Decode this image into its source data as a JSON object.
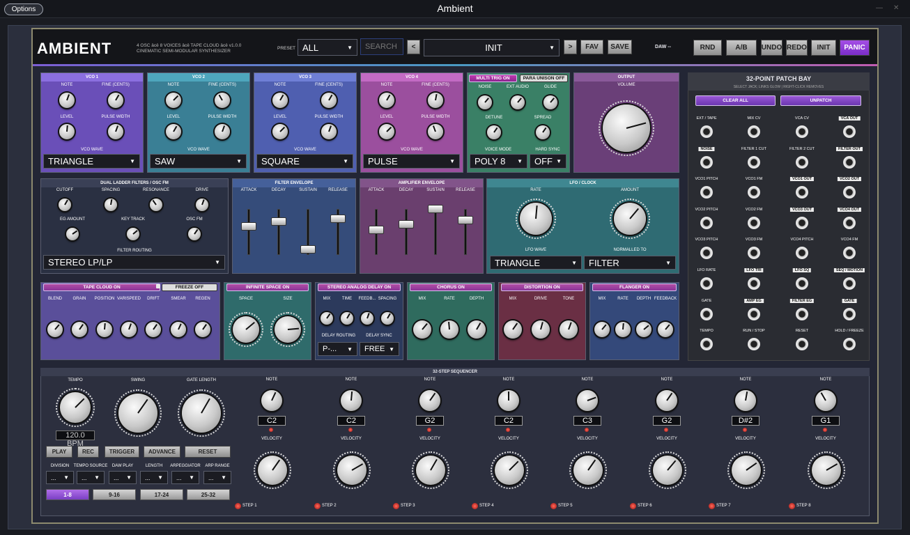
{
  "window": {
    "options": "Options",
    "title": "Ambient"
  },
  "header": {
    "logo": "AMBIENT",
    "subtitle1": "4 OSC  âcê  8 VOICES  âcê  TAPE CLOUD  âcê  v1.0.0",
    "subtitle2": "CINEMATIC SEMI-MODULAR SYNTHESIZER",
    "preset_label": "PRESET",
    "preset_value": "ALL",
    "search_placeholder": "SEARCH",
    "prev": "<",
    "patch": "INIT",
    "next": ">",
    "fav": "FAV",
    "save": "SAVE",
    "daw": "DAW --",
    "rnd": "RND",
    "ab": "A/B",
    "undo": "UNDO",
    "redo": "REDO",
    "init": "INIT",
    "panic": "PANIC"
  },
  "vco": [
    {
      "title": "VCO 1",
      "wave": "TRIANGLE"
    },
    {
      "title": "VCO 2",
      "wave": "SAW"
    },
    {
      "title": "VCO 3",
      "wave": "SQUARE"
    },
    {
      "title": "VCO 4",
      "wave": "PULSE"
    }
  ],
  "vco_labels": {
    "note": "NOTE",
    "fine": "FINE (CENTS)",
    "level": "LEVEL",
    "pw": "PULSE WIDTH",
    "wave": "VCO WAVE"
  },
  "voice": {
    "multi": "MULTI TRIG ON",
    "para": "PARA UNISON OFF",
    "noise": "NOISE",
    "ext": "EXT AUDIO",
    "glide": "GLIDE",
    "detune": "DETUNE",
    "spread": "SPREAD",
    "mode_label": "VOICE MODE",
    "sync_label": "HARD SYNC",
    "mode": "POLY 8",
    "sync": "OFF"
  },
  "output": {
    "title": "OUTPUT",
    "volume": "VOLUME"
  },
  "filters": {
    "title": "DUAL LADDER FILTERS / OSC FM",
    "cutoff": "CUTOFF",
    "spacing": "SPACING",
    "resonance": "RESONANCE",
    "drive": "DRIVE",
    "eg": "EG AMOUNT",
    "key": "KEY TRACK",
    "oscfm": "OSC FM",
    "routing_label": "FILTER ROUTING",
    "routing": "STEREO LP/LP"
  },
  "fenv": {
    "title": "FILTER ENVELOPE",
    "a": "ATTACK",
    "d": "DECAY",
    "s": "SUSTAIN",
    "r": "RELEASE"
  },
  "aenv": {
    "title": "AMPLIFIER ENVELOPE",
    "a": "ATTACK",
    "d": "DECAY",
    "s": "SUSTAIN",
    "r": "RELEASE"
  },
  "lfo": {
    "title": "LFO / CLOCK",
    "rate": "RATE",
    "amount": "AMOUNT",
    "wave_label": "LFO WAVE",
    "norm_label": "NORMALLED TO",
    "wave": "TRIANGLE",
    "norm": "FILTER"
  },
  "tape": {
    "title": "TAPE CLOUD ON",
    "freeze": "FREEZE OFF",
    "k": [
      "BLEND",
      "GRAIN",
      "POSITION",
      "VARISPEED",
      "DRIFT",
      "SMEAR",
      "REGEN"
    ]
  },
  "space": {
    "title": "INFINITE SPACE ON",
    "k": [
      "SPACE",
      "SIZE"
    ]
  },
  "delay": {
    "title": "STEREO ANALOG DELAY ON",
    "k": [
      "MIX",
      "TIME",
      "FEEDB...",
      "SPACING"
    ],
    "routing_label": "DELAY ROUTING",
    "sync_label": "DELAY SYNC",
    "routing": "P-...",
    "sync": "FREE"
  },
  "chorus": {
    "title": "CHORUS ON",
    "k": [
      "MIX",
      "RATE",
      "DEPTH"
    ]
  },
  "dist": {
    "title": "DISTORTION ON",
    "k": [
      "MIX",
      "DRIVE",
      "TONE"
    ]
  },
  "flanger": {
    "title": "FLANGER ON",
    "k": [
      "MIX",
      "RATE",
      "DEPTH",
      "FEEDBACK"
    ]
  },
  "patchbay": {
    "title": "32-POINT PATCH BAY",
    "sub": "SELECT JACK; LINKS GLOW  |  RIGHT-CLICK REMOVES",
    "clear": "CLEAR ALL",
    "unpatch": "UNPATCH",
    "rows": [
      [
        [
          "EXT / TAPE",
          0
        ],
        [
          "MIX CV",
          0
        ],
        [
          "VCA CV",
          0
        ],
        [
          "VCA OUT",
          1
        ]
      ],
      [
        [
          "NOISE",
          1
        ],
        [
          "FILTER 1 CUT",
          0
        ],
        [
          "FILTER 2 CUT",
          0
        ],
        [
          "FILTER OUT",
          1
        ]
      ],
      [
        [
          "VCO1 PITCH",
          0
        ],
        [
          "VCO1 FM",
          0
        ],
        [
          "VCO1 OUT",
          1
        ],
        [
          "VCO2 OUT",
          1
        ]
      ],
      [
        [
          "VCO2 PITCH",
          0
        ],
        [
          "VCO2 FM",
          0
        ],
        [
          "VCO3 OUT",
          1
        ],
        [
          "VCO4 OUT",
          1
        ]
      ],
      [
        [
          "VCO3 PITCH",
          0
        ],
        [
          "VCO3 FM",
          0
        ],
        [
          "VCO4 PITCH",
          0
        ],
        [
          "VCO4 FM",
          0
        ]
      ],
      [
        [
          "LFO RATE",
          0
        ],
        [
          "LFO TRI",
          1
        ],
        [
          "LFO SQ",
          1
        ],
        [
          "SEQ / MOTION",
          1
        ]
      ],
      [
        [
          "GATE",
          0
        ],
        [
          "AMP EG",
          1
        ],
        [
          "FILTER EG",
          1
        ],
        [
          "GATE",
          1
        ]
      ],
      [
        [
          "TEMPO",
          0
        ],
        [
          "RUN / STOP",
          0
        ],
        [
          "RESET",
          0
        ],
        [
          "HOLD / FREEZE",
          0
        ]
      ]
    ]
  },
  "seq": {
    "title": "32-STEP SEQUENCER",
    "tempo": "TEMPO",
    "swing": "SWING",
    "gate": "GATE LENGTH",
    "bpm": "120.0 BPM",
    "play": "PLAY",
    "rec": "REC",
    "trigger": "TRIGGER",
    "advance": "ADVANCE",
    "reset": "RESET",
    "opt_labels": [
      "DIVISION",
      "TEMPO SOURCE",
      "DAW PLAY",
      "LENGTH",
      "ARPEGGIATOR",
      "ARP RANGE"
    ],
    "opt_value": "...",
    "pages": [
      "1-8",
      "9-16",
      "17-24",
      "25-32"
    ],
    "note_label": "NOTE",
    "vel_label": "VELOCITY",
    "steps": [
      {
        "note": "C2",
        "label": "STEP 1"
      },
      {
        "note": "C2",
        "label": "STEP 2"
      },
      {
        "note": "G2",
        "label": "STEP 3"
      },
      {
        "note": "C2",
        "label": "STEP 4"
      },
      {
        "note": "C3",
        "label": "STEP 5"
      },
      {
        "note": "G2",
        "label": "STEP 6"
      },
      {
        "note": "D#2",
        "label": "STEP 7"
      },
      {
        "note": "G1",
        "label": "STEP 8"
      }
    ]
  }
}
